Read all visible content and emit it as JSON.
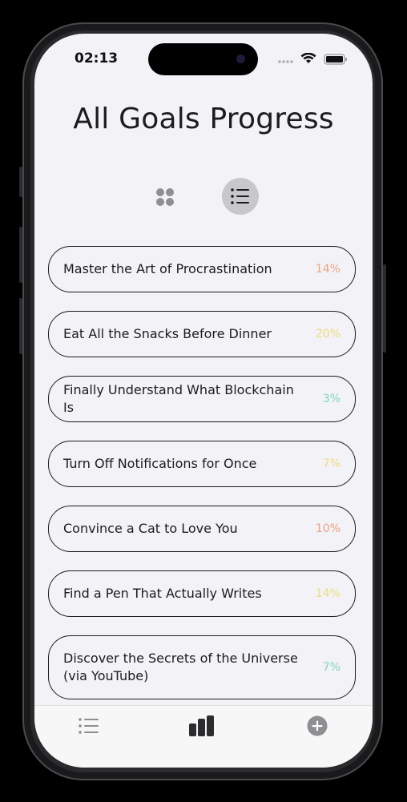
{
  "status": {
    "time": "02:13"
  },
  "header": {
    "title": "All Goals Progress"
  },
  "view_toggle": {
    "grid_icon": "grid-icon",
    "list_icon": "list-icon",
    "selected": "list"
  },
  "goals": [
    {
      "name": "Master the Art of Procrastination",
      "percent": "14%",
      "color": "#f0a27e"
    },
    {
      "name": "Eat All the Snacks Before Dinner",
      "percent": "20%",
      "color": "#eedd7a"
    },
    {
      "name": "Finally Understand What Blockchain Is",
      "percent": "3%",
      "color": "#7fd6b6"
    },
    {
      "name": "Turn Off Notifications for Once",
      "percent": "7%",
      "color": "#eedd7a"
    },
    {
      "name": "Convince a Cat to Love You",
      "percent": "10%",
      "color": "#f0a27e"
    },
    {
      "name": "Find a Pen That Actually Writes",
      "percent": "14%",
      "color": "#eedd7a"
    },
    {
      "name": "Discover the Secrets of the Universe (via YouTube)",
      "percent": "7%",
      "color": "#7fd6b6"
    }
  ],
  "tabbar": {
    "items": [
      {
        "icon": "list-icon"
      },
      {
        "icon": "bar-chart-icon",
        "active": true
      },
      {
        "icon": "plus-circle-icon"
      }
    ]
  }
}
